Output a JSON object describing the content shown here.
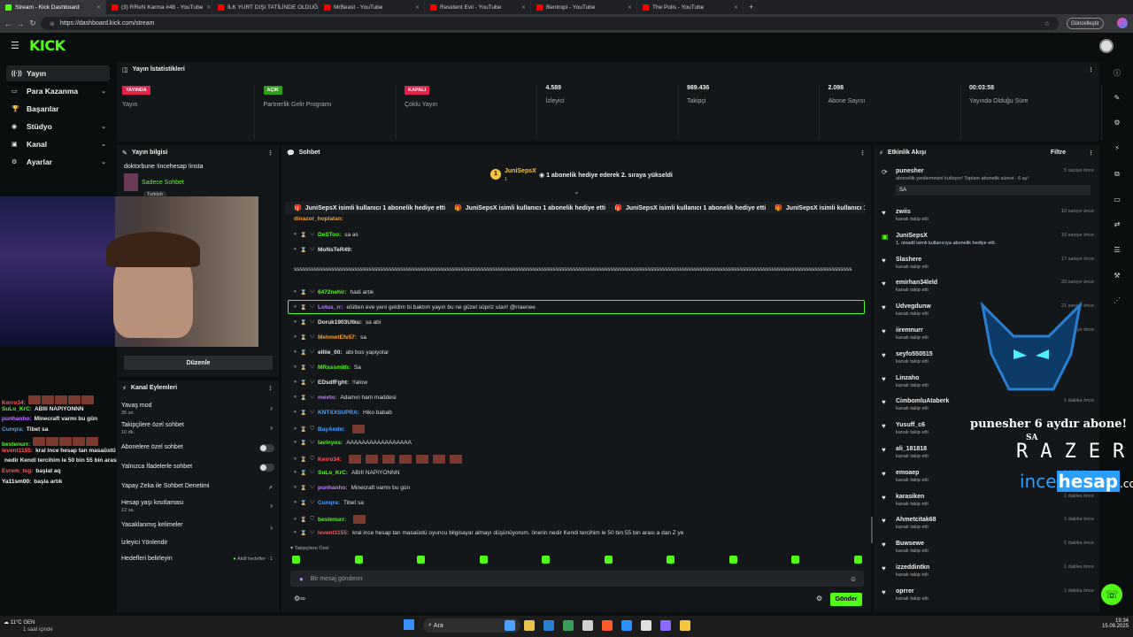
{
  "browser": {
    "tabs": [
      {
        "title": "Stream - Kick Dashboard",
        "color": "#53fc18",
        "active": true
      },
      {
        "title": "(3) RReN Karma #48 - YouTube",
        "color": "#ff0000"
      },
      {
        "title": "İLK YURT DIŞI TATİLİNDE OLDUĞ...",
        "color": "#ff0000"
      },
      {
        "title": "MrBeast - YouTube",
        "color": "#ff0000"
      },
      {
        "title": "Resident Evil - YouTube",
        "color": "#ff0000"
      },
      {
        "title": "Bentropi - YouTube",
        "color": "#ff0000"
      },
      {
        "title": "The Polis - YouTube",
        "color": "#ff0000"
      }
    ],
    "url": "https://dashboard.kick.com/stream",
    "update_label": "Güncelleştir"
  },
  "brand": {
    "logo": "KICK",
    "accent": "#53fc18"
  },
  "sidebar": {
    "items": [
      {
        "label": "Yayın",
        "icon": "broadcast-icon",
        "active": true,
        "chevron": false
      },
      {
        "label": "Para Kazanma",
        "icon": "wallet-icon",
        "chevron": true
      },
      {
        "label": "Başarılar",
        "icon": "trophy-icon",
        "chevron": false
      },
      {
        "label": "Stüdyo",
        "icon": "studio-icon",
        "chevron": true
      },
      {
        "label": "Kanal",
        "icon": "channel-icon",
        "chevron": true
      },
      {
        "label": "Ayarlar",
        "icon": "gear-icon",
        "chevron": true
      }
    ]
  },
  "stats": {
    "title": "Yayın İstatistikleri",
    "cards": [
      {
        "badge": "YAYINDA",
        "badge_color": "#e5224a",
        "label": "Yayın"
      },
      {
        "badge": "AÇIK",
        "badge_color": "#2f9e1a",
        "label": "Partnerlik Gelir Programı"
      },
      {
        "badge": "KAPALI",
        "badge_color": "#e5224a",
        "label": "Çoklu Yayın"
      },
      {
        "value": "4.589",
        "label": "İzleyici"
      },
      {
        "value": "989.436",
        "label": "Takipçi"
      },
      {
        "value": "2.098",
        "label": "Abone Sayısı"
      },
      {
        "value": "00:03:58",
        "label": "Yayında Olduğu Süre"
      }
    ]
  },
  "stream_info": {
    "title": "Yayın bilgisi",
    "stream_title": "doktorbune !incehesap !insta",
    "category": "Sadece Sohbet",
    "tag": "Turkish",
    "edit_button": "Düzenle"
  },
  "channel_actions": {
    "title": "Kanal Eylemleri",
    "items": [
      {
        "label": "Yavaş mod",
        "sub": "35 sn.",
        "control": "arrow"
      },
      {
        "label": "Takipçilere özel sohbet",
        "sub": "10 dk.",
        "control": "arrow"
      },
      {
        "label": "Abonelere özel sohbet",
        "sub": "",
        "control": "toggle"
      },
      {
        "label": "Yalnızca İfadelerle sohbet",
        "sub": "",
        "control": "toggle"
      },
      {
        "label": "Yapay Zeka ile Sohbet Denetimi",
        "sub": "",
        "control": "external"
      },
      {
        "label": "Hesap yaşı kısıtlaması",
        "sub": "12 sa.",
        "control": "arrow"
      },
      {
        "label": "Yasaklanmış kelimeler",
        "sub": "",
        "control": "arrow"
      },
      {
        "label": "İzleyici Yönlendir",
        "sub": "",
        "control": "none"
      },
      {
        "label": "Hedefleri belirleyin",
        "sub": "",
        "control": "goal",
        "extra": "Aktif hedefler · 1"
      }
    ]
  },
  "chat": {
    "title": "Sohbet",
    "pinned_user": "JuniSepsX",
    "pinned_count": "1",
    "pinned_text": "1 abonelik hediye ederek 2. sıraya yükseldi",
    "ticker": "JuniSepsX isimli kullanıcı 1 abonelik hediye etti",
    "cut_user": "dinazor_hoplatan:",
    "messages": [
      {
        "user": "DeSToo:",
        "color": "#53fc18",
        "text": "sa as"
      },
      {
        "user": "MoNsTeR49:",
        "color": "#e5e5e5",
        "text": "ssssssssssssssssssssssssssssssssssssssssssssssssssssssssssssssssssssssssssssssssssssssssssssssssssssssssssssssssssssssssssssssssssssssssssssssssssssssssssssssssssssssssssssssssssssssssssssssssss"
      },
      {
        "user": "6472nehir:",
        "color": "#53fc18",
        "text": "hadi artık"
      },
      {
        "user": "Lotus_rr:",
        "color": "#c07cff",
        "text": "elütten eve yeni geldim bi baktım yayın bu ne güzel süpriz ulan! @rraenee"
      },
      {
        "user": "Doruk1903Utku:",
        "color": "#e5e5e5",
        "text": "sa abi"
      },
      {
        "user": "MehmetEfe57:",
        "color": "#f0a030",
        "text": "sa"
      },
      {
        "user": "elliie_00:",
        "color": "#e5e5e5",
        "text": "abi bos yapiyolar"
      },
      {
        "user": "MRsssmith:",
        "color": "#53fc18",
        "text": "Sa"
      },
      {
        "user": "EDsdfFght:",
        "color": "#e5e5e5",
        "text": "!!alow"
      },
      {
        "user": "mevto:",
        "color": "#c07cff",
        "text": "Adamın ham maddesi"
      },
      {
        "user": "KNTXXSUPRA:",
        "color": "#4aa3ff",
        "text": "Hiko babab"
      },
      {
        "user": "BayAndo:",
        "color": "#4aa3ff",
        "text": ""
      },
      {
        "user": "lavinyos:",
        "color": "#53fc18",
        "text": "AAAAAAAAAAAAAAAAA"
      },
      {
        "user": "Kerro34:",
        "color": "#ff5a5a",
        "text": ""
      },
      {
        "user": "SuLo_KrC:",
        "color": "#53fc18",
        "text": "ABIII NAPIYONNN"
      },
      {
        "user": "punhanho:",
        "color": "#c07cff",
        "text": "Minecraft varmı bu gün"
      },
      {
        "user": "Cunqra:",
        "color": "#4aa3ff",
        "text": "Tibet sa"
      },
      {
        "user": "bestenurr:",
        "color": "#53fc18",
        "text": ""
      },
      {
        "user": "levent1155:",
        "color": "#ff5a5a",
        "text": "kral ince hesap tan masaüstü oyuncu bilgisayar almayı düşünüyorum. önerin nedir Kendi tercihim le 50 bin 55 bin arası a dan Z ye"
      }
    ],
    "followers_only_label": "Takipçilere Özel",
    "input_placeholder": "Bir mesaj gönderin",
    "send_label": "Gönder"
  },
  "activity": {
    "title": "Etkinlik Akışı",
    "filter_label": "Filtre",
    "first": {
      "user": "punesher",
      "time": "5 saniye önce",
      "text": "aboneliik yenilemesini kutluyor! Toplam abonelik süresi - 6 ay!",
      "msg": "SA"
    },
    "items": [
      {
        "user": "zwiis",
        "sub": "kanalı takip etti",
        "time": "10 saniye önce"
      },
      {
        "user": "JuniSepsX",
        "sub": "1, nisadil isimli kullanıcıya abonelik hediye etti.",
        "time": "16 saniye önce",
        "gift": true
      },
      {
        "user": "Slashere",
        "sub": "kanalı takip etti",
        "time": "17 saniye önce"
      },
      {
        "user": "emirhan34leld",
        "sub": "kanalı takip etti",
        "time": "20 saniye önce"
      },
      {
        "user": "Udvegdunw",
        "sub": "kanalı takip etti",
        "time": "21 saniye önce"
      },
      {
        "user": "iiremnurr",
        "sub": "kanalı takip etti",
        "time": "39 saniye önce"
      },
      {
        "user": "seyfo550515",
        "sub": "kanalı takip etti",
        "time": ""
      },
      {
        "user": "Linzaho",
        "sub": "kanalı takip etti",
        "time": ""
      },
      {
        "user": "CimbomluAtaberk",
        "sub": "kanalı takip etti",
        "time": "1 dakika önce"
      },
      {
        "user": "Yusuff_c6",
        "sub": "kanalı takip etti",
        "time": ""
      },
      {
        "user": "ali_181818",
        "sub": "kanalı takip etti",
        "time": ""
      },
      {
        "user": "emoaep",
        "sub": "kanalı takip etti",
        "time": "1 dakika önce"
      },
      {
        "user": "karasiken",
        "sub": "kanalı takip etti",
        "time": "1 dakika önce"
      },
      {
        "user": "Ahmetcitak68",
        "sub": "kanalı takip etti",
        "time": "1 dakika önce"
      },
      {
        "user": "Buwsewe",
        "sub": "kanalı takip etti",
        "time": "1 dakika önce"
      },
      {
        "user": "izzeddintkn",
        "sub": "kanalı takip etti",
        "time": "1 dakika önce"
      },
      {
        "user": "oprrer",
        "sub": "kanalı takip etti",
        "time": "1 dakika önce"
      }
    ]
  },
  "overlay": {
    "sub_alert": "punesher 6 aydır abone!",
    "sub_alert_msg": "SA",
    "sponsor1": "RAZER",
    "sponsor2_a": "ince",
    "sponsor2_b": "hesap",
    "sponsor2_c": ".com",
    "chat": [
      {
        "user": "Kerro34:",
        "color": "#ff5a5a",
        "text": ""
      },
      {
        "user": "SuLo_KrC:",
        "color": "#53fc18",
        "text": "ABIII NAPIYONNN"
      },
      {
        "user": "punhanho:",
        "color": "#c07cff",
        "text": "Minecraft varmı bu gün"
      },
      {
        "user": "Cunqra:",
        "color": "#4aa3ff",
        "text": "Tibet sa"
      },
      {
        "user": "bestenurr:",
        "color": "#53fc18",
        "text": ""
      },
      {
        "user": "levent1155:",
        "color": "#ff5a5a",
        "text": "kral ince hesap tan masaüstü oyuncu bilgisayar almayı düşünüyorum. önerin"
      },
      {
        "user": "",
        "color": "#ffffff",
        "text": "nedir Kendi tercihim le 50 bin 55 bin arası a dan Z ye"
      },
      {
        "user": "Evrem_tsg:",
        "color": "#ff5a5a",
        "text": "başlat aq"
      },
      {
        "user": "Ya11sm00:",
        "color": "#ffffff",
        "text": "başla artık"
      }
    ]
  },
  "taskbar": {
    "weather_temp": "11°C",
    "weather_text": "GEN",
    "bottom_text": "1 saat içinde",
    "search_label": "Ara",
    "time": "19:34",
    "date": "15.09.2025"
  }
}
